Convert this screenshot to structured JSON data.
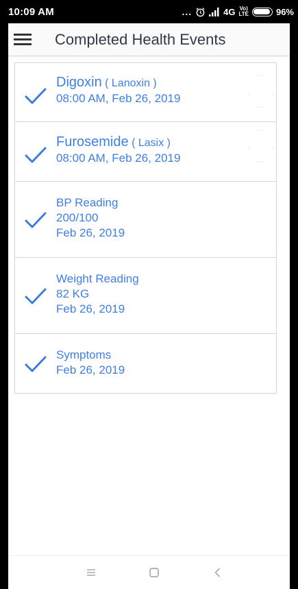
{
  "status_bar": {
    "time": "10:09 AM",
    "dots": "...",
    "network": "4G",
    "net_top": "Vo)",
    "net_bottom": "LTE",
    "battery": "96%",
    "battery_level": 0.96
  },
  "header": {
    "title": "Completed Health Events",
    "menu_icon": "hamburger-menu-icon"
  },
  "events": [
    {
      "type": "medication",
      "name": "Digoxin",
      "brand": "( Lanoxin )",
      "time": "08:00 AM, Feb 26, 2019",
      "icon": "checkmark-icon"
    },
    {
      "type": "medication",
      "name": "Furosemide",
      "brand": "( Lasix )",
      "time": "08:00 AM, Feb 26, 2019",
      "icon": "checkmark-icon"
    },
    {
      "type": "reading",
      "title": "BP Reading",
      "value": "200/100",
      "date": "Feb 26, 2019",
      "icon": "checkmark-icon"
    },
    {
      "type": "reading",
      "title": "Weight Reading",
      "value": "82 KG",
      "date": "Feb 26, 2019",
      "icon": "checkmark-icon"
    },
    {
      "type": "symptom",
      "title": "Symptoms",
      "date": "Feb 26, 2019",
      "icon": "checkmark-icon"
    }
  ],
  "colors": {
    "accent": "#3f7fe0",
    "check": "#3b7ddd",
    "title": "#2f3a45",
    "divider": "#d4d4d4"
  },
  "nav_bar": {
    "buttons": [
      "menu-icon",
      "home-square-icon",
      "back-chevron-icon"
    ]
  }
}
